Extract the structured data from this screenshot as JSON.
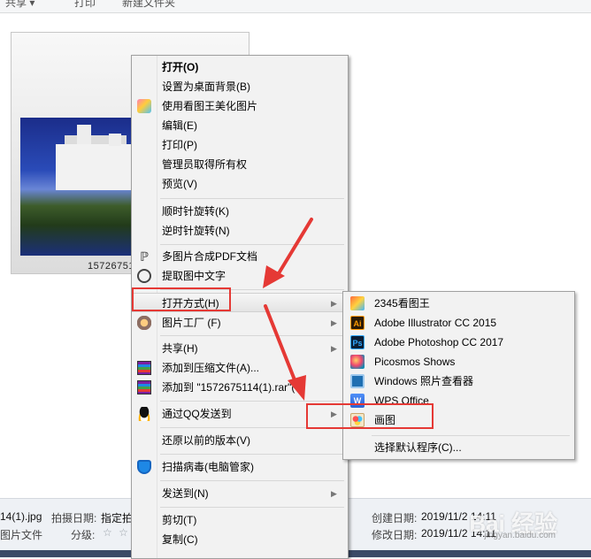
{
  "toolbar": {
    "share": "共享 ▾",
    "print": "打印",
    "new_folder": "新建文件夹"
  },
  "thumbnail": {
    "label": "15726751"
  },
  "status": {
    "filename": "14(1).jpg",
    "filetype": "图片文件",
    "shot_date_label": "拍摄日期:",
    "shot_date_value": "指定拍",
    "rating_label": "分级:",
    "rating_stars": "☆ ☆",
    "created_label": "创建日期:",
    "created_value": "2019/11/2 14:11",
    "modified_label": "修改日期:",
    "modified_value": "2019/11/2 14:11"
  },
  "context_menu": {
    "items": [
      {
        "label": "打开(O)",
        "bold": true
      },
      {
        "label": "设置为桌面背景(B)"
      },
      {
        "label": "使用看图王美化图片",
        "icon": "meitu-icon"
      },
      {
        "label": "编辑(E)"
      },
      {
        "label": "打印(P)"
      },
      {
        "label": "管理员取得所有权"
      },
      {
        "label": "预览(V)"
      },
      {
        "label": "顺时针旋转(K)"
      },
      {
        "label": "逆时针旋转(N)"
      },
      {
        "label": "多图片合成PDF文档",
        "icon": "pdf-icon"
      },
      {
        "label": "提取图中文字",
        "icon": "ocr-icon"
      },
      {
        "label": "打开方式(H)",
        "submenu": true
      },
      {
        "label": "图片工厂 (F)",
        "icon": "picture-factory-icon",
        "submenu": true
      },
      {
        "label": "共享(H)",
        "submenu": true
      },
      {
        "label": "添加到压缩文件(A)...",
        "icon": "winrar-icon"
      },
      {
        "label": "添加到 \"1572675114(1).rar\"(T)",
        "icon": "winrar-icon"
      },
      {
        "label": "通过QQ发送到",
        "icon": "qq-icon",
        "submenu": true
      },
      {
        "label": "还原以前的版本(V)"
      },
      {
        "label": "扫描病毒(电脑管家)",
        "icon": "shield-icon"
      },
      {
        "label": "发送到(N)",
        "submenu": true
      },
      {
        "label": "剪切(T)"
      },
      {
        "label": "复制(C)"
      }
    ]
  },
  "open_with_submenu": {
    "items": [
      {
        "label": "2345看图王",
        "icon": "2345-picwang-icon"
      },
      {
        "label": "Adobe Illustrator CC 2015",
        "icon": "illustrator-icon",
        "glyph": "Ai"
      },
      {
        "label": "Adobe Photoshop CC 2017",
        "icon": "photoshop-icon",
        "glyph": "Ps"
      },
      {
        "label": "Picosmos Shows",
        "icon": "picosmos-icon"
      },
      {
        "label": "Windows 照片查看器",
        "icon": "photo-viewer-icon"
      },
      {
        "label": "WPS Office",
        "icon": "wps-icon",
        "glyph": "W"
      },
      {
        "label": "画图",
        "icon": "paint-icon"
      },
      {
        "label": "选择默认程序(C)..."
      }
    ]
  },
  "watermark": {
    "text": "Bai 经验",
    "url": "jingyan.baidu.com"
  }
}
